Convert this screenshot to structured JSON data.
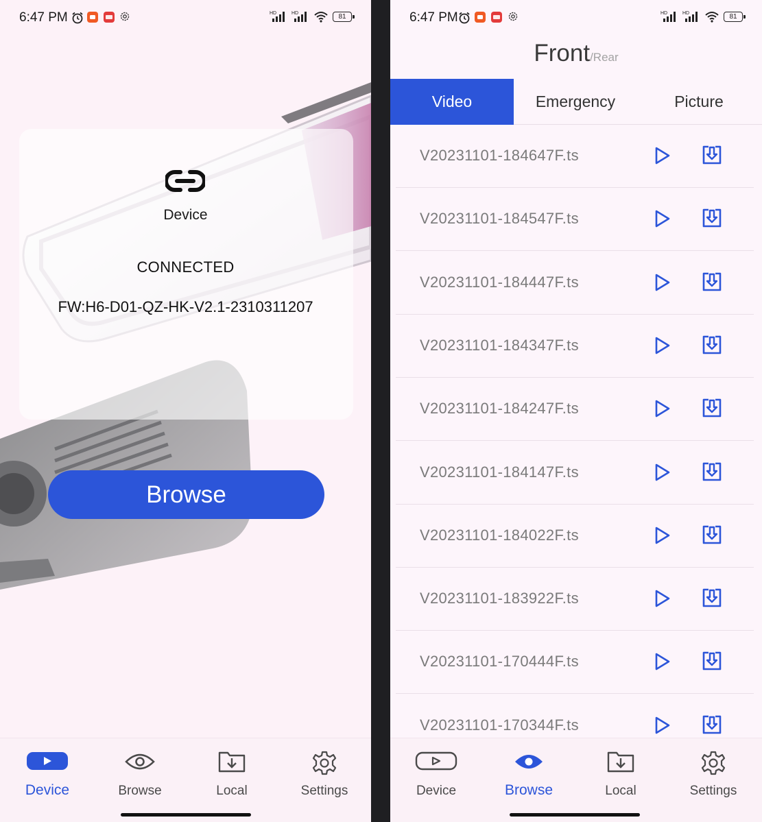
{
  "status_bar": {
    "time": "6:47 PM",
    "battery": "81",
    "signal_1": "HD",
    "signal_2": "HD"
  },
  "device_screen": {
    "card_label": "Device",
    "connection_status": "CONNECTED",
    "firmware": "FW:H6-D01-QZ-HK-V2.1-2310311207",
    "browse_button": "Browse"
  },
  "browse_screen": {
    "title": "Front",
    "title_alt": "/Rear",
    "tabs": [
      {
        "label": "Video",
        "active": true
      },
      {
        "label": "Emergency",
        "active": false
      },
      {
        "label": "Picture",
        "active": false
      }
    ],
    "files": [
      "V20231101-184647F.ts",
      "V20231101-184547F.ts",
      "V20231101-184447F.ts",
      "V20231101-184347F.ts",
      "V20231101-184247F.ts",
      "V20231101-184147F.ts",
      "V20231101-184022F.ts",
      "V20231101-183922F.ts",
      "V20231101-170444F.ts",
      "V20231101-170344F.ts"
    ]
  },
  "nav": {
    "items": [
      {
        "label": "Device",
        "icon": "play-rect-icon"
      },
      {
        "label": "Browse",
        "icon": "eye-icon"
      },
      {
        "label": "Local",
        "icon": "folder-download-icon"
      },
      {
        "label": "Settings",
        "icon": "gear-icon"
      }
    ]
  },
  "colors": {
    "accent": "#2c55d9",
    "background": "#fdf2f8",
    "divider": "#1f1f22"
  }
}
